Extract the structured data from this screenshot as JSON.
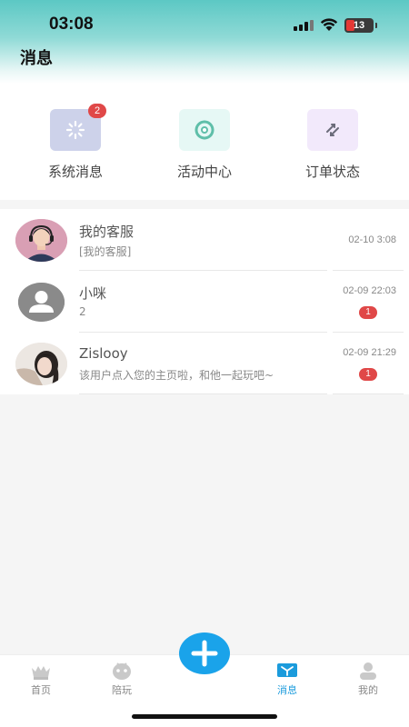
{
  "status_bar": {
    "time": "03:08",
    "battery": "13"
  },
  "page": {
    "title": "消息"
  },
  "quick_actions": [
    {
      "label": "系统消息",
      "badge": "2",
      "icon": "sparkle-icon",
      "bg": "#cdd2ea"
    },
    {
      "label": "活动中心",
      "badge": "",
      "icon": "swirl-icon",
      "bg": "#e6f8f5"
    },
    {
      "label": "订单状态",
      "badge": "",
      "icon": "refresh-icon",
      "bg": "#f2e9fb"
    }
  ],
  "conversations": [
    {
      "name": "我的客服",
      "preview": "[我的客服]",
      "time": "02-10 3:08",
      "unread": "",
      "avatar": "support-avatar"
    },
    {
      "name": "小咪",
      "preview": "2",
      "time": "02-09 22:03",
      "unread": "1",
      "avatar": "default-avatar"
    },
    {
      "name": "Zislooy",
      "preview": "该用户点入您的主页啦，和他一起玩吧~",
      "time": "02-09 21:29",
      "unread": "1",
      "avatar": "photo-avatar"
    }
  ],
  "tabbar": {
    "items": [
      {
        "label": "首页",
        "icon": "home-icon",
        "active": false
      },
      {
        "label": "陪玩",
        "icon": "game-icon",
        "active": false
      },
      {
        "label": "消息",
        "icon": "message-icon",
        "active": true
      },
      {
        "label": "我的",
        "icon": "profile-icon",
        "active": false
      }
    ],
    "fab_icon": "plus-icon"
  },
  "colors": {
    "accent": "#1aa3ea",
    "badge": "#e04848",
    "header_teal": "#5cc8c4"
  }
}
